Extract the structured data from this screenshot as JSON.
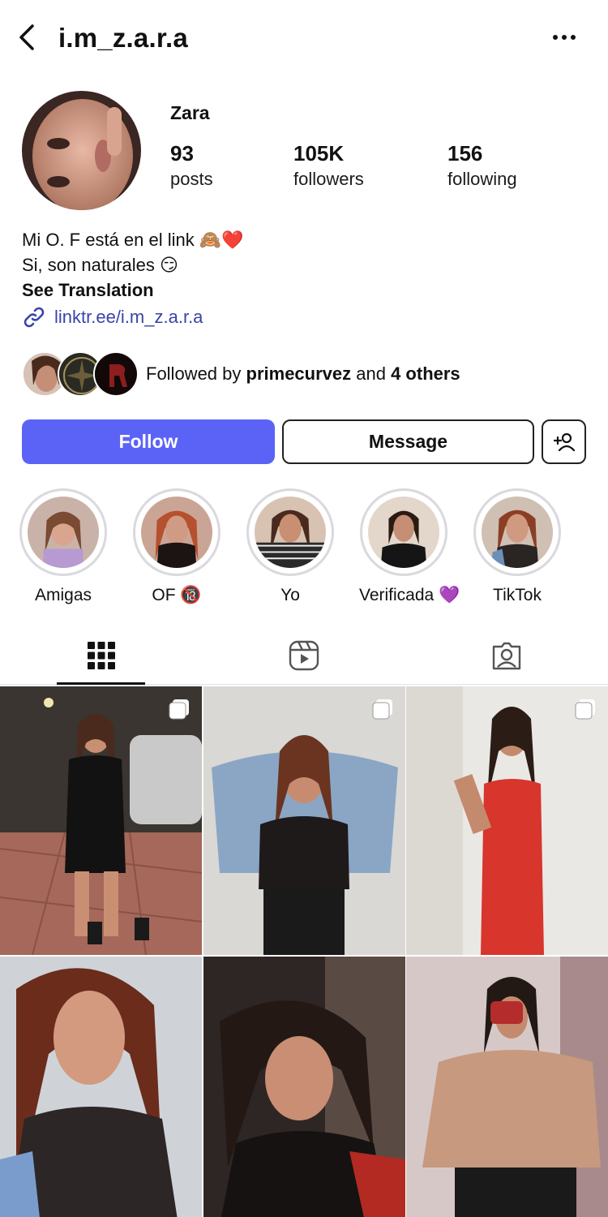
{
  "header": {
    "username": "i.m_z.a.r.a"
  },
  "profile": {
    "display_name": "Zara",
    "stats": [
      {
        "value": "93",
        "label": "posts"
      },
      {
        "value": "105K",
        "label": "followers"
      },
      {
        "value": "156",
        "label": "following"
      }
    ],
    "bio": {
      "line1": "Mi O. F está en el link 🙈❤️",
      "line2": "Si, son naturales 😏",
      "translate": "See Translation",
      "link": "linktr.ee/i.m_z.a.r.a"
    },
    "followed_by": {
      "prefix": "Followed by ",
      "name": "primecurvez",
      "middle": " and ",
      "others": "4 others"
    }
  },
  "actions": {
    "follow": "Follow",
    "message": "Message"
  },
  "highlights": [
    {
      "label": "Amigas"
    },
    {
      "label": "OF 🔞"
    },
    {
      "label": "Yo"
    },
    {
      "label": "Verificada 💜"
    },
    {
      "label": "TikTok"
    }
  ],
  "tabs": [
    "grid-icon",
    "reels-icon",
    "tagged-icon"
  ],
  "colors": {
    "accent": "#5b63f7",
    "link": "#3a44a8",
    "ring": "#d9d9de"
  }
}
